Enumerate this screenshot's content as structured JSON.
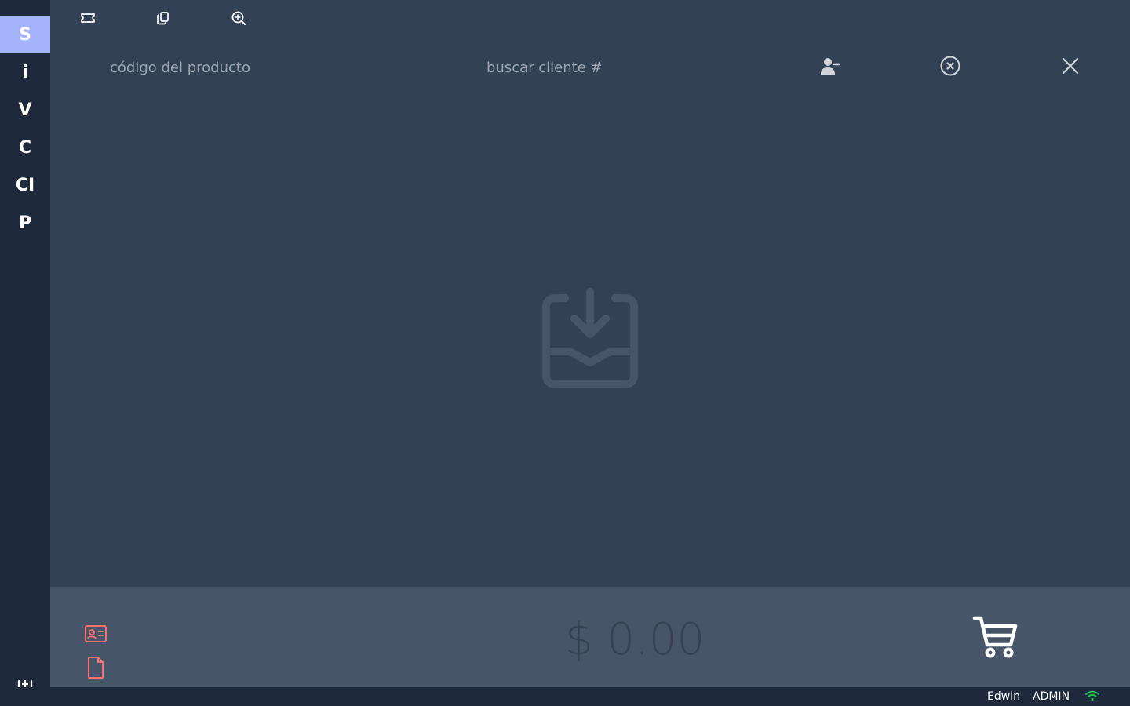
{
  "sidebar": {
    "items": [
      {
        "label": "S",
        "active": true
      },
      {
        "label": "i",
        "active": false
      },
      {
        "label": "V",
        "active": false
      },
      {
        "label": "C",
        "active": false
      },
      {
        "label": "CI",
        "active": false
      },
      {
        "label": "P",
        "active": false
      }
    ],
    "settings_icon": "sliders-icon"
  },
  "toolbar": {
    "icons": [
      "ticket-icon",
      "copy-icon",
      "zoom-in-icon"
    ]
  },
  "search": {
    "product_value": "código del producto",
    "product_placeholder": "código del producto",
    "client_placeholder": "buscar cliente #"
  },
  "header_actions": {
    "icons": [
      "remove-user-icon",
      "clear-circle-icon",
      "close-icon"
    ]
  },
  "empty_state": {
    "icon": "inbox-download-icon"
  },
  "footer": {
    "total": "$ 0.00",
    "icons": [
      "id-card-icon",
      "document-icon",
      "cart-icon"
    ]
  },
  "status": {
    "user": "Edwin",
    "role": "ADMIN",
    "connection_icon": "wifi-icon"
  },
  "colors": {
    "sidebar_bg": "#1e293b",
    "active_item": "#a5b4fc",
    "main_bg": "#334155",
    "footer_bg": "#475569",
    "accent_red": "#f87171",
    "online_green": "#22c55e"
  }
}
